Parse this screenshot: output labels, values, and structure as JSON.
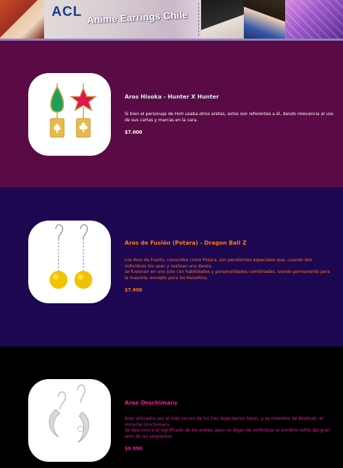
{
  "header": {
    "logo_text": "ACL",
    "title": "Anime Earrings Chile"
  },
  "products": [
    {
      "name": "Aros Hisoka - Hunter X Hunter",
      "description": "Si bien el personaje de HxH usaba otros aretes, estos son referentes a él, dando relevancia al uso de sus cartas y marcas en la cara.",
      "price": "$7.000"
    },
    {
      "name": "Aros de Fusión (Potara) - Dragon Ball Z",
      "description": "Los Aros de Fusión, conocidos como Potara, son pendientes especiales que, cuando dos individuos los usan y realizan una danza,\nse fusionan en uno solo con habilidades y personalidades combinadas, siendo permanente para la mayoría, excepto para los Kaioshins.",
      "price": "$7.900"
    },
    {
      "name": "Aros Orochimaru",
      "description": "Aros utilizados por el más oscuro de los tres legendarios Sanin, y ex miembro de Akatsuki, el inmortal Orochimaru.\nSe desconoce el significado de los aretes, pero no dejan de simbolizar el sombrío estilo del gran amo de las serpientes.",
      "price": "$9.990"
    }
  ],
  "colors": {
    "section_1_bg": "#5a0a44",
    "section_2_bg": "#1c0750",
    "section_3_bg": "#000000",
    "section_2_text": "#ff7a1a",
    "section_3_text": "#e91ea3"
  }
}
